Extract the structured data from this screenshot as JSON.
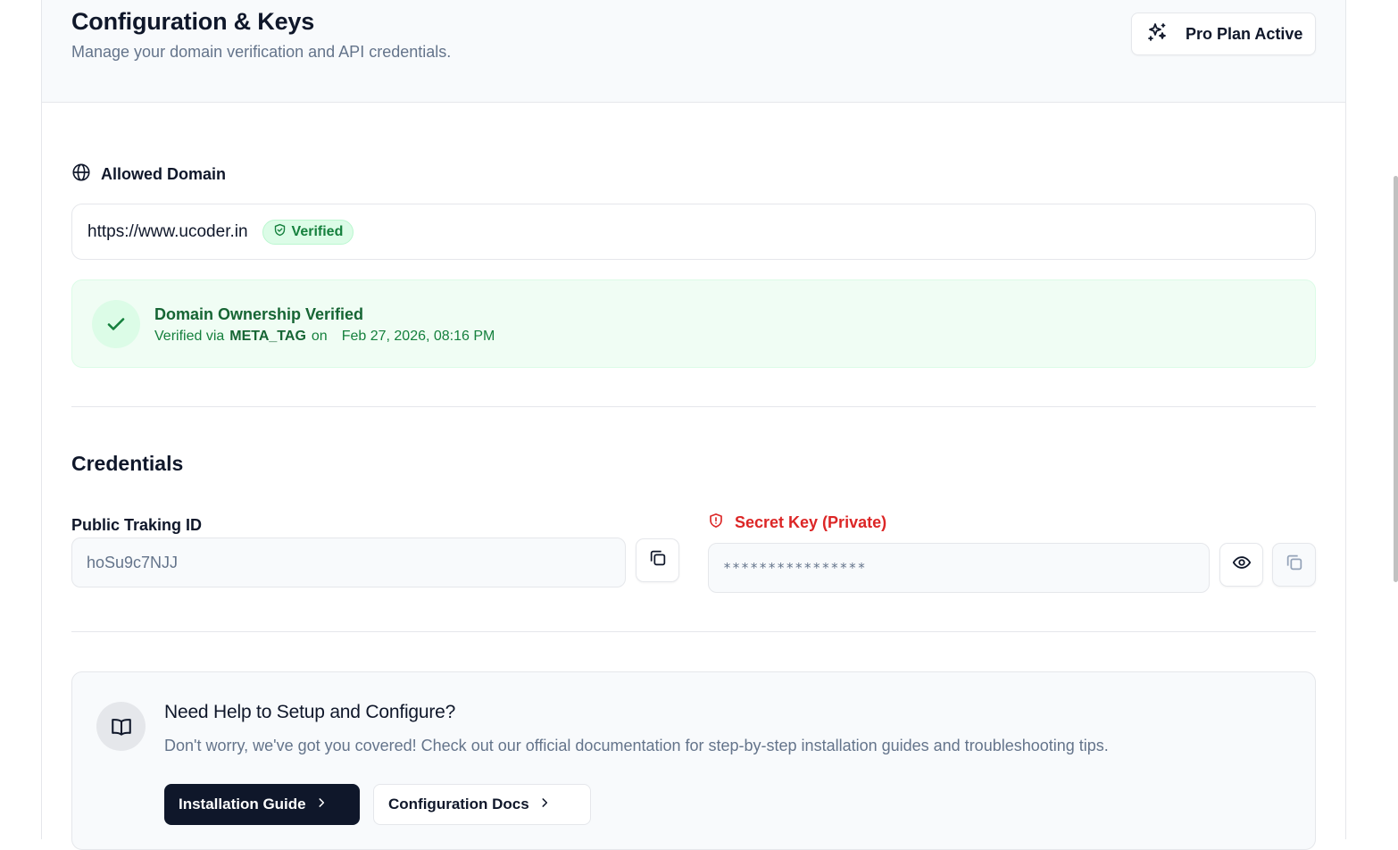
{
  "header": {
    "title": "Configuration & Keys",
    "subtitle": "Manage your domain verification and API credentials.",
    "plan_badge": "Pro Plan Active"
  },
  "domain": {
    "section_label": "Allowed Domain",
    "url": "https://www.ucoder.in",
    "status": "Verified",
    "ownership_title": "Domain Ownership Verified",
    "verified_via_prefix": "Verified via",
    "method": "META_TAG",
    "on_word": "on",
    "verified_date": "Feb 27, 2026, 08:16 PM"
  },
  "credentials": {
    "title": "Credentials",
    "public_label": "Public Traking ID",
    "public_id": "hoSu9c7NJJ",
    "secret_label": "Secret Key (Private)",
    "secret_masked": "****************"
  },
  "help": {
    "title": "Need Help to Setup and Configure?",
    "description": "Don't worry, we've got you covered! Check out our official documentation for step-by-step installation guides and troubleshooting tips.",
    "primary_button": "Installation Guide",
    "secondary_button": "Configuration Docs"
  },
  "colors": {
    "success": "#15803d",
    "danger": "#dc2626",
    "primary": "#0f172a"
  },
  "icons": {
    "plan": "sparkles-icon",
    "domain": "globe-icon",
    "verified": "shield-check-icon",
    "ownership": "check-icon",
    "secret": "shield-alert-icon",
    "copy": "copy-icon",
    "reveal": "eye-icon",
    "help": "book-open-icon",
    "arrow": "chevron-right-icon"
  }
}
